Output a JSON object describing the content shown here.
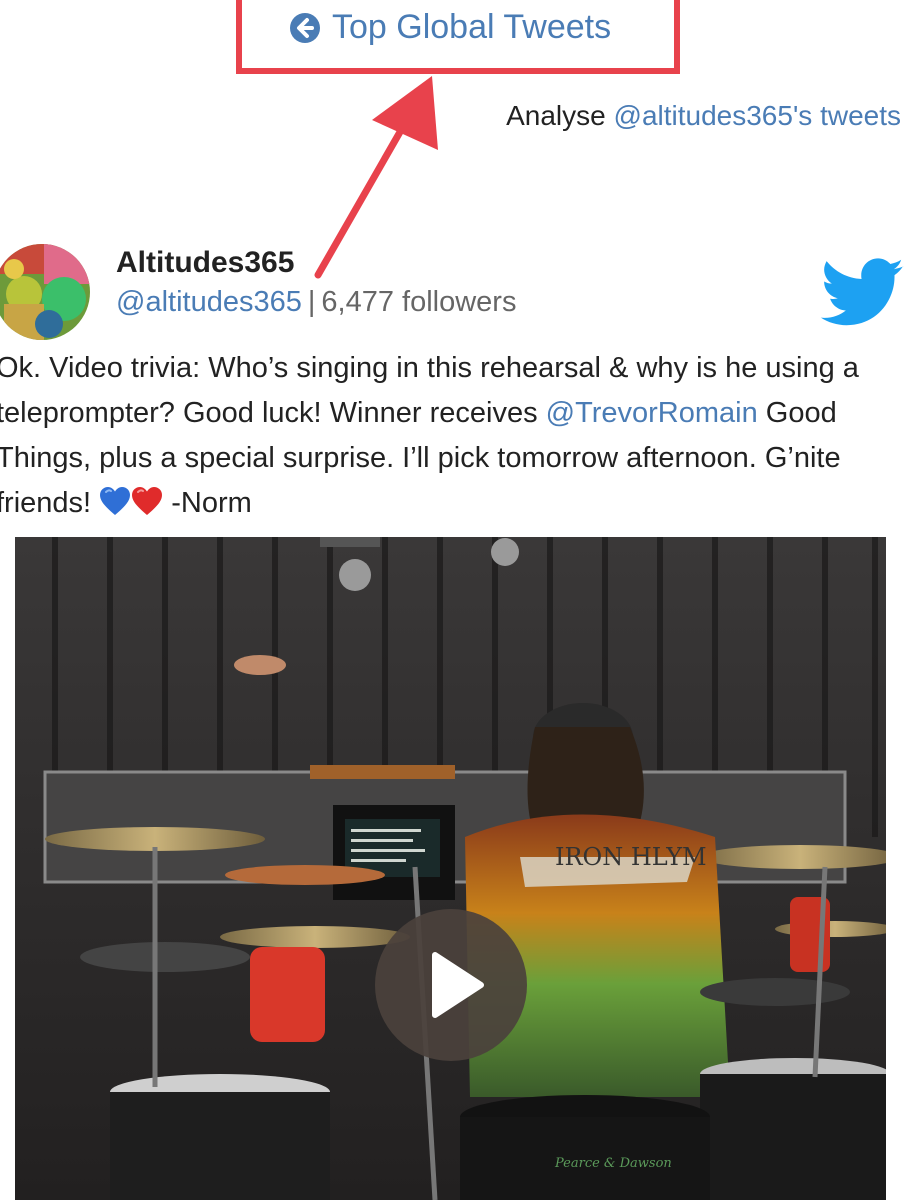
{
  "nav": {
    "back_label": "Top Global Tweets"
  },
  "analyse": {
    "prefix": "Analyse",
    "link": "@altitudes365's tweets"
  },
  "author": {
    "name": "Altitudes365",
    "handle": "@altitudes365",
    "separator": "|",
    "followers": "6,477 followers"
  },
  "tweet": {
    "text_1": "Ok. Video trivia: Who’s singing in this rehearsal & why is he using a teleprompter? Good luck! Winner receives ",
    "mention": "@TrevorRomain",
    "text_2": " Good Things, plus a special surprise. I’ll pick tomorrow afternoon. G’nite friends! ",
    "text_3": " -Norm"
  },
  "video": {
    "shirt_text": "IRON HLYM",
    "drum_brand_text": "Pearce & Dawson"
  },
  "icons": {
    "back": "arrow-left-circle-icon",
    "twitter": "twitter-bird-icon",
    "blue_heart": "blue-heart-icon",
    "red_heart": "red-heart-icon",
    "play": "play-icon"
  },
  "colors": {
    "link": "#4a7cb5",
    "annotation": "#e8424c",
    "twitter_blue": "#1da1f2"
  }
}
